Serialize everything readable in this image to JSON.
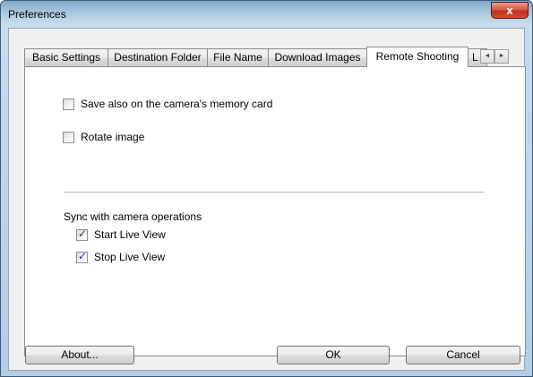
{
  "window": {
    "title": "Preferences",
    "close_glyph": "x"
  },
  "tabs": [
    {
      "label": "Basic Settings",
      "active": false
    },
    {
      "label": "Destination Folder",
      "active": false
    },
    {
      "label": "File Name",
      "active": false
    },
    {
      "label": "Download Images",
      "active": false
    },
    {
      "label": "Remote Shooting",
      "active": true
    },
    {
      "label": "L",
      "active": false
    }
  ],
  "tab_scroll": {
    "left_glyph": "◄",
    "right_glyph": "►"
  },
  "options": {
    "save_card": {
      "label": "Save also on the camera's memory card",
      "checked": false
    },
    "rotate": {
      "label": "Rotate image",
      "checked": false
    }
  },
  "sync": {
    "label": "Sync with camera operations",
    "start_live_view": {
      "label": "Start Live View",
      "checked": true
    },
    "stop_live_view": {
      "label": "Stop Live View",
      "checked": true
    }
  },
  "buttons": {
    "about": "About...",
    "ok": "OK",
    "cancel": "Cancel"
  }
}
